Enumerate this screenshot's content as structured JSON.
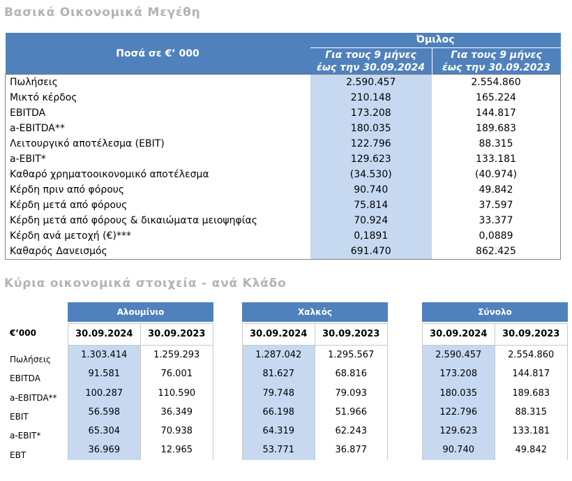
{
  "section1": {
    "title": "Βασικά Οικονομικά Μεγέθη",
    "header_label": "Ποσά  σε €’ 000",
    "group": "Όμιλος",
    "col1_line1": "Για τους 9 μήνες",
    "col1_line2": "έως την 30.09.2024",
    "col2_line1": "Για τους 9 μήνες",
    "col2_line2": "έως την 30.09.2023",
    "rows": [
      {
        "label": "Πωλήσεις",
        "v2024": "2.590.457",
        "v2023": "2.554.860"
      },
      {
        "label": "Μικτό κέρδος",
        "v2024": "210.148",
        "v2023": "165.224"
      },
      {
        "label": "EBITDA",
        "v2024": "173.208",
        "v2023": "144.817"
      },
      {
        "label": "a-EBITDA**",
        "v2024": "180.035",
        "v2023": "189.683"
      },
      {
        "label": "Λειτουργικό αποτέλεσμα (EBIT)",
        "v2024": "122.796",
        "v2023": "88.315"
      },
      {
        "label": "a-EBIT*",
        "v2024": "129.623",
        "v2023": "133.181"
      },
      {
        "label": "Καθαρό χρηματοοικονομικό αποτέλεσμα",
        "v2024": "(34.530)",
        "v2023": "(40.974)"
      },
      {
        "label": "Κέρδη πριν από φόρους",
        "v2024": "90.740",
        "v2023": "49.842"
      },
      {
        "label": "Κέρδη μετά από φόρους",
        "v2024": "75.814",
        "v2023": "37.597"
      },
      {
        "label": "Κέρδη μετά από φόρους & δικαιώματα μειοψηφίας",
        "v2024": "70.924",
        "v2023": "33.377"
      },
      {
        "label": "Κέρδη ανά μετοχή (€)***",
        "v2024": "0,1891",
        "v2023": "0,0889"
      },
      {
        "label": "Καθαρός Δανεισμός",
        "v2024": "691.470",
        "v2023": "862.425"
      }
    ]
  },
  "section2": {
    "title": "Κύρια οικονομικά στοιχεία - ανά Κλάδο",
    "unit_label": "€’000",
    "row_labels": [
      "Πωλήσεις",
      "EBITDA",
      "a-EBITDA**",
      "EBIT",
      "a-EBIT*",
      "EBT"
    ],
    "segments": [
      {
        "name": "Αλουμίνιο",
        "d1": "30.09.2024",
        "d2": "30.09.2023",
        "values": [
          [
            "1.303.414",
            "1.259.293"
          ],
          [
            "91.581",
            "76.001"
          ],
          [
            "100.287",
            "110.590"
          ],
          [
            "56.598",
            "36.349"
          ],
          [
            "65.304",
            "70.938"
          ],
          [
            "36.969",
            "12.965"
          ]
        ]
      },
      {
        "name": "Χαλκός",
        "d1": "30.09.2024",
        "d2": "30.09.2023",
        "values": [
          [
            "1.287.042",
            "1.295.567"
          ],
          [
            "81.627",
            "68.816"
          ],
          [
            "79.748",
            "79.093"
          ],
          [
            "66.198",
            "51.966"
          ],
          [
            "64.319",
            "62.243"
          ],
          [
            "53.771",
            "36.877"
          ]
        ]
      },
      {
        "name": "Σύνολο",
        "d1": "30.09.2024",
        "d2": "30.09.2023",
        "values": [
          [
            "2.590.457",
            "2.554.860"
          ],
          [
            "173.208",
            "144.817"
          ],
          [
            "180.035",
            "189.683"
          ],
          [
            "122.796",
            "88.315"
          ],
          [
            "129.623",
            "133.181"
          ],
          [
            "90.740",
            "49.842"
          ]
        ]
      }
    ]
  }
}
